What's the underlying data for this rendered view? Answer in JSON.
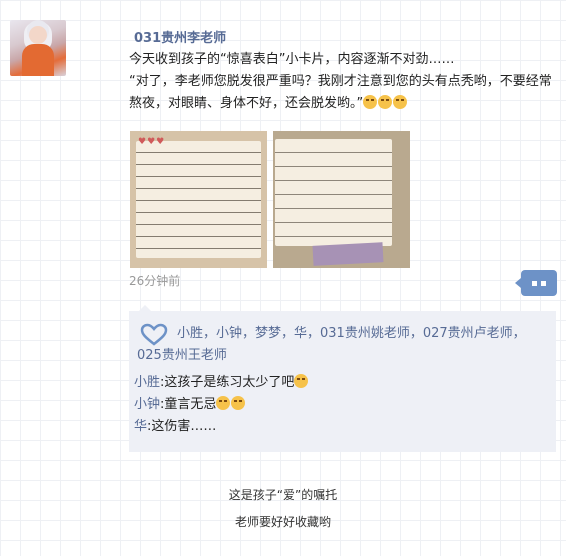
{
  "post": {
    "author": "031贵州李老师",
    "text_line1": "今天收到孩子的“惊喜表白”小卡片，内容逐渐不对劲……",
    "text_line2": "“对了，李老师您脱发很严重吗？我刚才注意到您的头有点秃哟，不要经常熬夜，对眼睛、身体不好，还会脱发哟。”",
    "emojis": [
      "teary-laugh-emoji",
      "teary-laugh-emoji",
      "teary-laugh-emoji"
    ],
    "photos": [
      "handwritten-card-photo-1",
      "handwritten-card-photo-2"
    ],
    "time": "26分钟前"
  },
  "likes": {
    "names": "小胜，小钟，梦梦，华，031贵州姚老师，027贵州卢老师，025贵州王老师"
  },
  "comments": [
    {
      "name": "小胜",
      "sep": ":",
      "msg": "这孩子是练习太少了吧"
    },
    {
      "name": "小钟",
      "sep": ":",
      "msg": "童言无忌"
    },
    {
      "name": "华",
      "sep": ":",
      "msg": "这伤害……"
    }
  ],
  "captions": {
    "line1": "这是孩子“爱”的嘱托",
    "line2": "老师要好好收藏哟"
  },
  "colors": {
    "name_link": "#576b95",
    "more_button": "#6d92c7",
    "comment_bg": "#eef0f6"
  }
}
